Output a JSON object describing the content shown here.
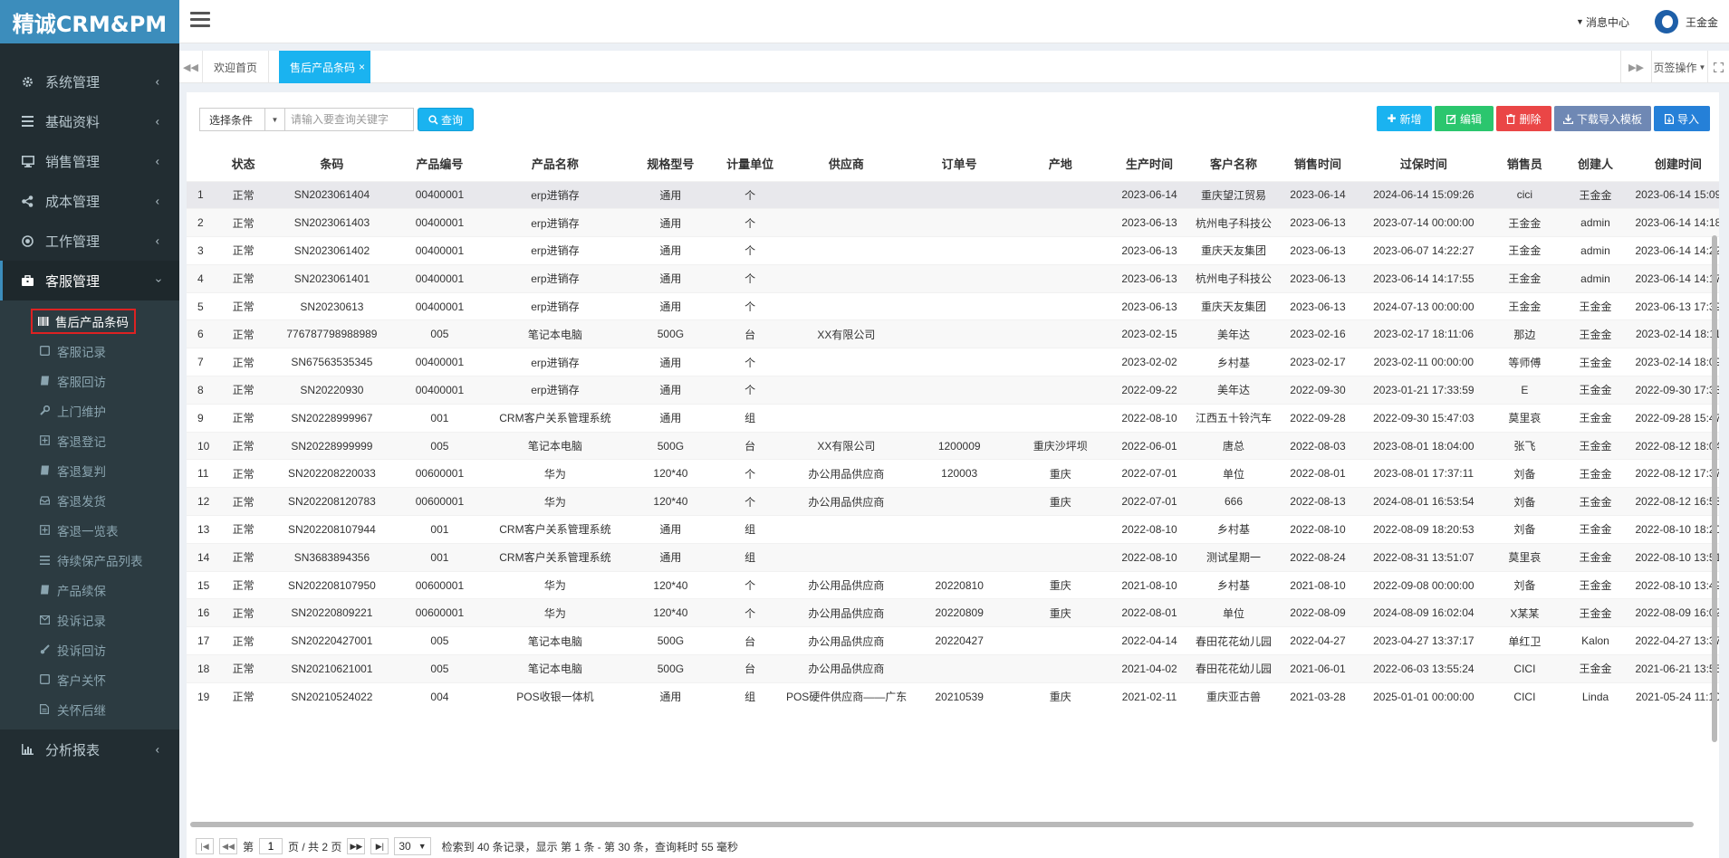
{
  "app": {
    "logo": "精诚CRM&PM"
  },
  "header": {
    "messages": "消息中心",
    "user": "王金金"
  },
  "sidebar": {
    "items": [
      {
        "label": "系统管理",
        "icon": "gear-icon"
      },
      {
        "label": "基础资料",
        "icon": "list-icon"
      },
      {
        "label": "销售管理",
        "icon": "monitor-icon"
      },
      {
        "label": "成本管理",
        "icon": "share-icon"
      },
      {
        "label": "工作管理",
        "icon": "target-icon"
      },
      {
        "label": "客服管理",
        "icon": "briefcase-icon"
      },
      {
        "label": "分析报表",
        "icon": "bar-chart-icon"
      }
    ],
    "sub": [
      {
        "label": "售后产品条码",
        "icon": "barcode-icon"
      },
      {
        "label": "客服记录",
        "icon": "square-icon"
      },
      {
        "label": "客服回访",
        "icon": "book-icon"
      },
      {
        "label": "上门维护",
        "icon": "wrench-icon"
      },
      {
        "label": "客退登记",
        "icon": "plus-square-icon"
      },
      {
        "label": "客退复判",
        "icon": "book-icon"
      },
      {
        "label": "客退发货",
        "icon": "inbox-icon"
      },
      {
        "label": "客退一览表",
        "icon": "plus-square-icon"
      },
      {
        "label": "待续保产品列表",
        "icon": "list-icon"
      },
      {
        "label": "产品续保",
        "icon": "book-icon"
      },
      {
        "label": "投诉记录",
        "icon": "envelope-icon"
      },
      {
        "label": "投诉回访",
        "icon": "brush-icon"
      },
      {
        "label": "客户关怀",
        "icon": "square-icon"
      },
      {
        "label": "关怀后继",
        "icon": "file-icon"
      }
    ]
  },
  "tabs": {
    "home": "欢迎首页",
    "current": "售后产品条码",
    "close": "×",
    "ops": "页签操作"
  },
  "search": {
    "condition": "选择条件",
    "placeholder": "请输入要查询关键字",
    "button": "查询"
  },
  "actions": {
    "add": "新增",
    "edit": "编辑",
    "delete": "删除",
    "download": "下载导入模板",
    "import": "导入"
  },
  "table": {
    "columns": [
      "",
      "状态",
      "条码",
      "产品编号",
      "产品名称",
      "规格型号",
      "计量单位",
      "供应商",
      "订单号",
      "产地",
      "生产时间",
      "客户名称",
      "销售时间",
      "过保时间",
      "销售员",
      "创建人",
      "创建时间"
    ],
    "rows": [
      [
        "1",
        "正常",
        "SN2023061404",
        "00400001",
        "erp进销存",
        "通用",
        "个",
        "",
        "",
        "",
        "2023-06-14",
        "重庆望江贸易",
        "2023-06-14",
        "2024-06-14 15:09:26",
        "cici",
        "王金金",
        "2023-06-14 15:09"
      ],
      [
        "2",
        "正常",
        "SN2023061403",
        "00400001",
        "erp进销存",
        "通用",
        "个",
        "",
        "",
        "",
        "2023-06-13",
        "杭州电子科技公",
        "2023-06-13",
        "2023-07-14 00:00:00",
        "王金金",
        "admin",
        "2023-06-14 14:18"
      ],
      [
        "3",
        "正常",
        "SN2023061402",
        "00400001",
        "erp进销存",
        "通用",
        "个",
        "",
        "",
        "",
        "2023-06-13",
        "重庆天友集团",
        "2023-06-13",
        "2023-06-07 14:22:27",
        "王金金",
        "admin",
        "2023-06-14 14:22"
      ],
      [
        "4",
        "正常",
        "SN2023061401",
        "00400001",
        "erp进销存",
        "通用",
        "个",
        "",
        "",
        "",
        "2023-06-13",
        "杭州电子科技公",
        "2023-06-13",
        "2023-06-14 14:17:55",
        "王金金",
        "admin",
        "2023-06-14 14:17"
      ],
      [
        "5",
        "正常",
        "SN20230613",
        "00400001",
        "erp进销存",
        "通用",
        "个",
        "",
        "",
        "",
        "2023-06-13",
        "重庆天友集团",
        "2023-06-13",
        "2024-07-13 00:00:00",
        "王金金",
        "王金金",
        "2023-06-13 17:39"
      ],
      [
        "6",
        "正常",
        "776787798988989",
        "005",
        "笔记本电脑",
        "500G",
        "台",
        "XX有限公司",
        "",
        "",
        "2023-02-15",
        "美年达",
        "2023-02-16",
        "2023-02-17 18:11:06",
        "那边",
        "王金金",
        "2023-02-14 18:11"
      ],
      [
        "7",
        "正常",
        "SN67563535345",
        "00400001",
        "erp进销存",
        "通用",
        "个",
        "",
        "",
        "",
        "2023-02-02",
        "乡村基",
        "2023-02-17",
        "2023-02-11 00:00:00",
        "等师傅",
        "王金金",
        "2023-02-14 18:09"
      ],
      [
        "8",
        "正常",
        "SN20220930",
        "00400001",
        "erp进销存",
        "通用",
        "个",
        "",
        "",
        "",
        "2022-09-22",
        "美年达",
        "2022-09-30",
        "2023-01-21 17:33:59",
        "E",
        "王金金",
        "2022-09-30 17:33"
      ],
      [
        "9",
        "正常",
        "SN20228999967",
        "001",
        "CRM客户关系管理系统",
        "通用",
        "组",
        "",
        "",
        "",
        "2022-08-10",
        "江西五十铃汽车",
        "2022-09-28",
        "2022-09-30 15:47:03",
        "莫里哀",
        "王金金",
        "2022-09-28 15:47"
      ],
      [
        "10",
        "正常",
        "SN20228999999",
        "005",
        "笔记本电脑",
        "500G",
        "台",
        "XX有限公司",
        "1200009",
        "重庆沙坪坝",
        "2022-06-01",
        "唐总",
        "2022-08-03",
        "2023-08-01 18:04:00",
        "张飞",
        "王金金",
        "2022-08-12 18:04"
      ],
      [
        "11",
        "正常",
        "SN202208220033",
        "00600001",
        "华为",
        "120*40",
        "个",
        "办公用品供应商",
        "120003",
        "重庆",
        "2022-07-01",
        "单位",
        "2022-08-01",
        "2023-08-01 17:37:11",
        "刘备",
        "王金金",
        "2022-08-12 17:37"
      ],
      [
        "12",
        "正常",
        "SN202208120783",
        "00600001",
        "华为",
        "120*40",
        "个",
        "办公用品供应商",
        "",
        "重庆",
        "2022-07-01",
        "666",
        "2022-08-13",
        "2024-08-01 16:53:54",
        "刘备",
        "王金金",
        "2022-08-12 16:53"
      ],
      [
        "13",
        "正常",
        "SN202208107944",
        "001",
        "CRM客户关系管理系统",
        "通用",
        "组",
        "",
        "",
        "",
        "2022-08-10",
        "乡村基",
        "2022-08-10",
        "2022-08-09 18:20:53",
        "刘备",
        "王金金",
        "2022-08-10 18:20"
      ],
      [
        "14",
        "正常",
        "SN3683894356",
        "001",
        "CRM客户关系管理系统",
        "通用",
        "组",
        "",
        "",
        "",
        "2022-08-10",
        "测试星期一",
        "2022-08-24",
        "2022-08-31 13:51:07",
        "莫里哀",
        "王金金",
        "2022-08-10 13:51"
      ],
      [
        "15",
        "正常",
        "SN202208107950",
        "00600001",
        "华为",
        "120*40",
        "个",
        "办公用品供应商",
        "20220810",
        "重庆",
        "2021-08-10",
        "乡村基",
        "2021-08-10",
        "2022-09-08 00:00:00",
        "刘备",
        "王金金",
        "2022-08-10 13:49"
      ],
      [
        "16",
        "正常",
        "SN20220809221",
        "00600001",
        "华为",
        "120*40",
        "个",
        "办公用品供应商",
        "20220809",
        "重庆",
        "2022-08-01",
        "单位",
        "2022-08-09",
        "2024-08-09 16:02:04",
        "X某某",
        "王金金",
        "2022-08-09 16:02"
      ],
      [
        "17",
        "正常",
        "SN20220427001",
        "005",
        "笔记本电脑",
        "500G",
        "台",
        "办公用品供应商",
        "20220427",
        "",
        "2022-04-14",
        "春田花花幼儿园",
        "2022-04-27",
        "2023-04-27 13:37:17",
        "单红卫",
        "Kalon",
        "2022-04-27 13:37"
      ],
      [
        "18",
        "正常",
        "SN20210621001",
        "005",
        "笔记本电脑",
        "500G",
        "台",
        "办公用品供应商",
        "",
        "",
        "2021-04-02",
        "春田花花幼儿园",
        "2021-06-01",
        "2022-06-03 13:55:24",
        "CICI",
        "王金金",
        "2021-06-21 13:55"
      ],
      [
        "19",
        "正常",
        "SN20210524022",
        "004",
        "POS收银一体机",
        "通用",
        "组",
        "POS硬件供应商——广东",
        "20210539",
        "重庆",
        "2021-02-11",
        "重庆亚古兽",
        "2021-03-28",
        "2025-01-01 00:00:00",
        "CICI",
        "Linda",
        "2021-05-24 11:10"
      ]
    ]
  },
  "pager": {
    "page_prefix": "第",
    "page": "1",
    "page_suffix": "页 / 共 2 页",
    "page_size": "30",
    "summary": "检索到 40 条记录，显示 第 1 条 - 第 30 条，查询耗时 55 毫秒"
  }
}
